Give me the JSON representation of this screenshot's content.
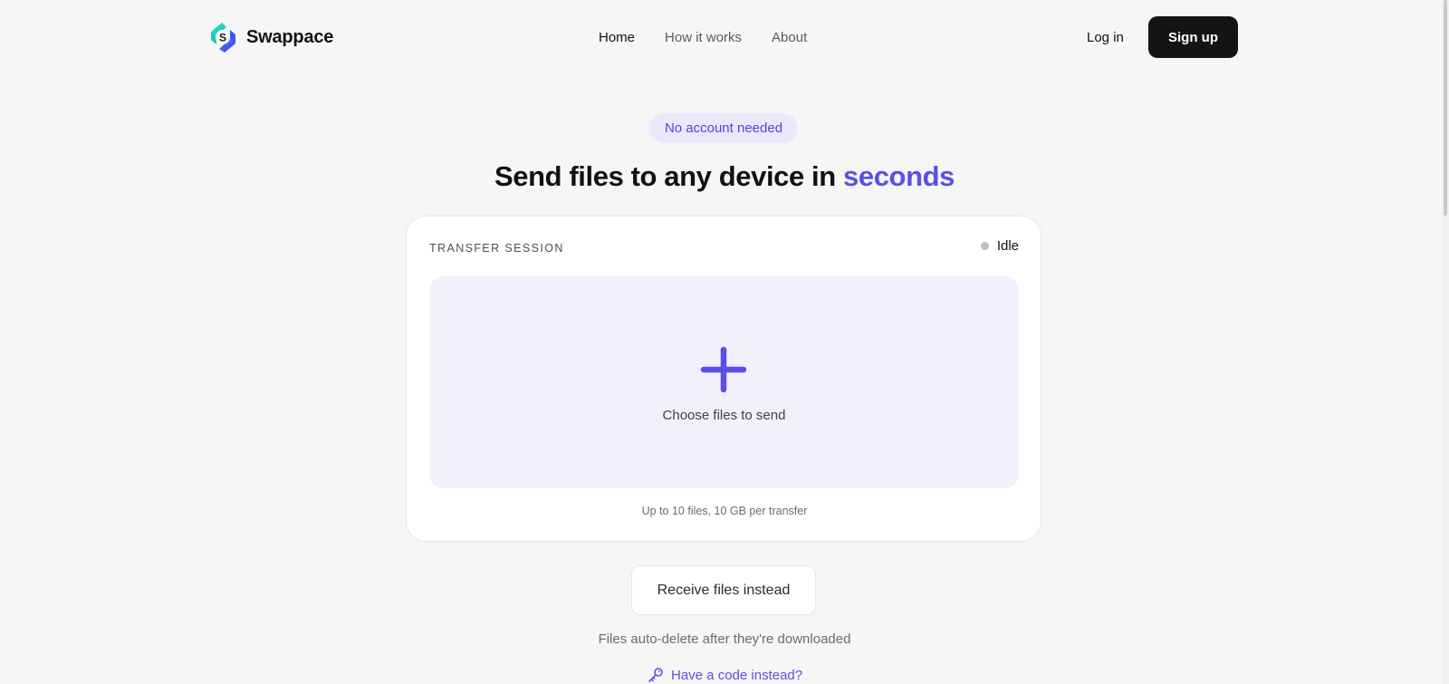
{
  "header": {
    "brand_name": "Swappace",
    "nav": [
      {
        "label": "Home",
        "active": true
      },
      {
        "label": "How it works",
        "active": false
      },
      {
        "label": "About",
        "active": false
      }
    ],
    "login_label": "Log in",
    "signup_label": "Sign up"
  },
  "hero": {
    "pill_text": "No account needed",
    "headline_main": "Send files to any device in ",
    "headline_accent": "seconds"
  },
  "card": {
    "label": "TRANSFER SESSION",
    "status": "Idle",
    "dropzone_label": "Choose files to send",
    "limit_note": "Up to 10 files, 10 GB per transfer"
  },
  "footer": {
    "receive_label": "Receive files instead",
    "auto_delete_note": "Files auto-delete after they're downloaded",
    "code_link_label": "Have a code instead?"
  },
  "icons": {
    "logo": "swappace-logo",
    "add": "plus-icon",
    "code": "key-icon",
    "status": "status-dot"
  },
  "colors": {
    "accent": "#5b4fe6",
    "pill_bg": "#ebe8fc",
    "dropzone_bg": "#f2f0fd",
    "dark_button": "#141416",
    "page_bg": "#f6f6f6",
    "status_idle": "#bdbdc2"
  }
}
